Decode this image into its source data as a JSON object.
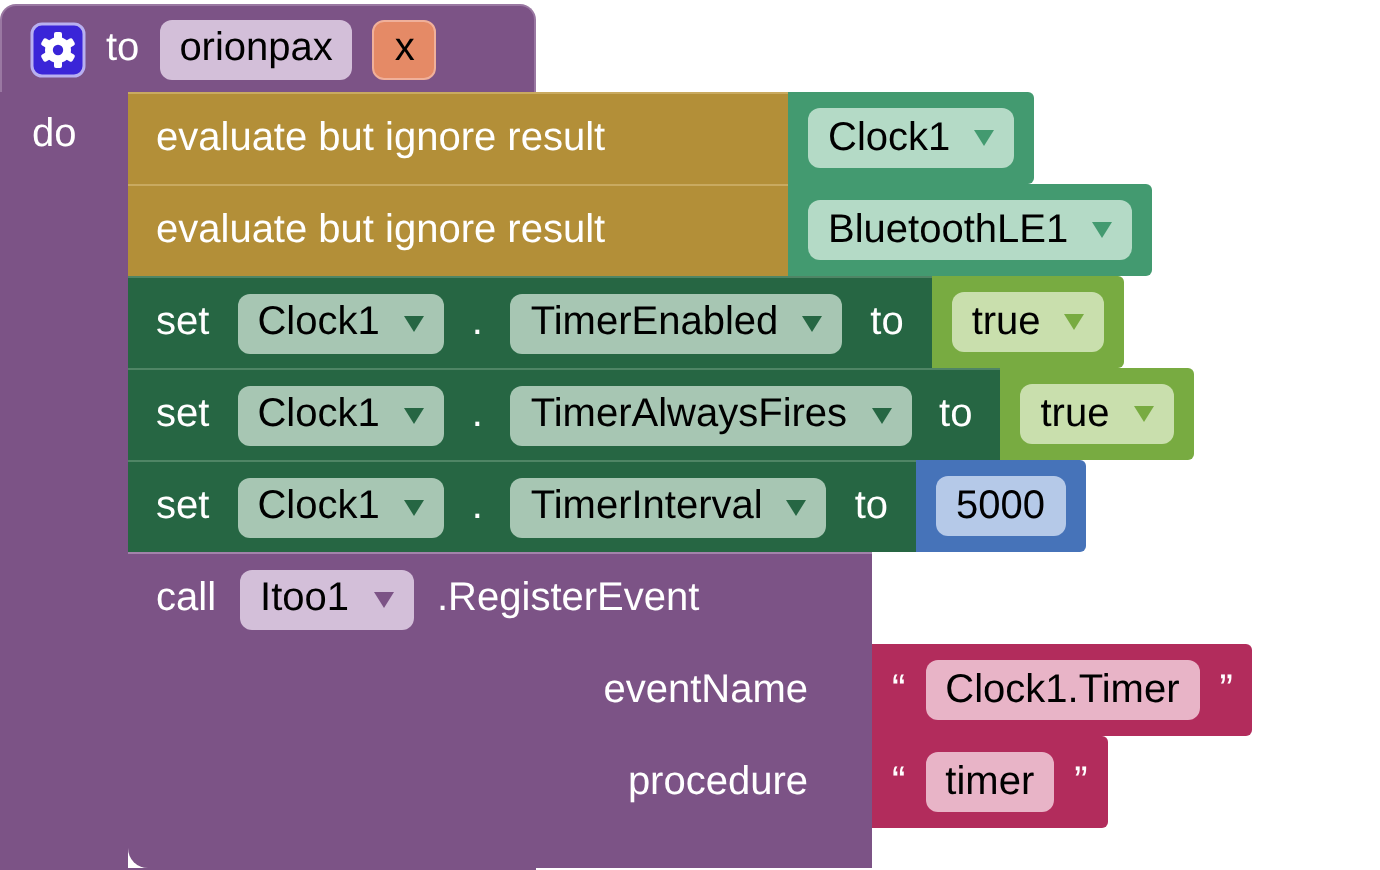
{
  "procedure": {
    "keyword_to": "to",
    "name": "orionpax",
    "params": [
      "x"
    ],
    "keyword_do": "do",
    "statements": [
      {
        "kind": "evaluate",
        "label": "evaluate but ignore result",
        "value": {
          "kind": "component",
          "text": "Clock1"
        }
      },
      {
        "kind": "evaluate",
        "label": "evaluate but ignore result",
        "value": {
          "kind": "component",
          "text": "BluetoothLE1"
        }
      },
      {
        "kind": "set",
        "keyword": "set",
        "component": "Clock1",
        "dot": ".",
        "property": "TimerEnabled",
        "keyword_to": "to",
        "value": {
          "kind": "logic",
          "text": "true"
        }
      },
      {
        "kind": "set",
        "keyword": "set",
        "component": "Clock1",
        "dot": ".",
        "property": "TimerAlwaysFires",
        "keyword_to": "to",
        "value": {
          "kind": "logic",
          "text": "true"
        }
      },
      {
        "kind": "set",
        "keyword": "set",
        "component": "Clock1",
        "dot": ".",
        "property": "TimerInterval",
        "keyword_to": "to",
        "value": {
          "kind": "number",
          "text": "5000"
        }
      },
      {
        "kind": "call",
        "keyword": "call",
        "component": "Itoo1",
        "method": ".RegisterEvent",
        "args": [
          {
            "name": "eventName",
            "value": {
              "kind": "text",
              "open_quote": "“",
              "text": "Clock1.Timer",
              "close_quote": "”"
            }
          },
          {
            "name": "procedure",
            "value": {
              "kind": "text",
              "open_quote": "“",
              "text": "timer",
              "close_quote": "”"
            }
          }
        ]
      }
    ]
  }
}
